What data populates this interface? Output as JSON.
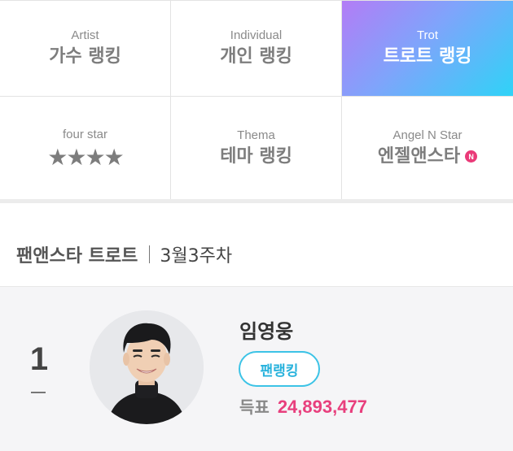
{
  "categories": [
    {
      "en": "Artist",
      "ko": "가수 랭킹"
    },
    {
      "en": "Individual",
      "ko": "개인 랭킹"
    },
    {
      "en": "Trot",
      "ko": "트로트 랭킹"
    },
    {
      "en": "four star",
      "ko": "★★★★"
    },
    {
      "en": "Thema",
      "ko": "테마 랭킹"
    },
    {
      "en": "Angel N Star",
      "ko": "엔젤앤스타",
      "badge": "N"
    }
  ],
  "active_category": "Trot",
  "section": {
    "title": "팬앤스타 트로트",
    "week": "3월3주차"
  },
  "ranking": [
    {
      "rank": "1",
      "change_icon": "dash-icon",
      "name": "임영웅",
      "fan_button": "팬랭킹",
      "votes_label": "득표",
      "votes": "24,893,477"
    }
  ],
  "colors": {
    "active_gradient": [
      "#b37cf6",
      "#7fa4fb",
      "#2fd3f7"
    ],
    "fan_button": "#3cc3e6",
    "votes": "#e83f7d",
    "badge": "#ea3a78"
  }
}
